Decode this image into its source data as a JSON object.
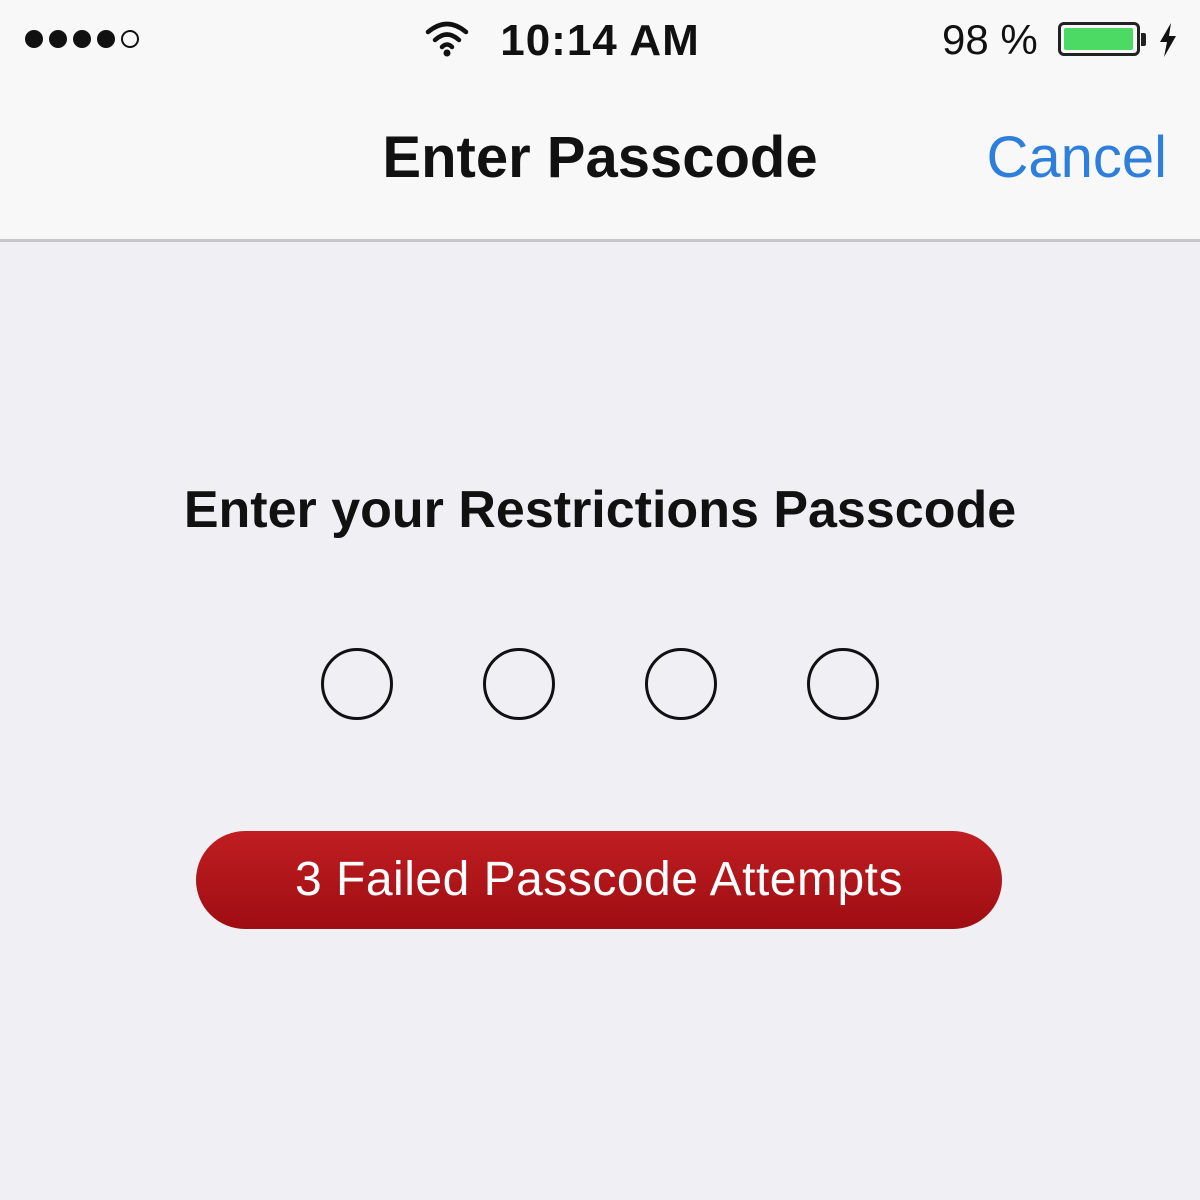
{
  "status_bar": {
    "signal_icon": "signal-strength-icon",
    "signal_bars_filled": 4,
    "signal_bars_total": 5,
    "wifi_icon": "wifi-icon",
    "time": "10:14 AM",
    "battery_percent": "98 %",
    "battery_level": 0.98,
    "battery_icon": "battery-icon",
    "battery_color": "#4cd964",
    "charging_icon": "charging-bolt-icon"
  },
  "nav_bar": {
    "title": "Enter Passcode",
    "cancel_label": "Cancel",
    "accent_color": "#2e7fdc"
  },
  "main": {
    "prompt": "Enter your Restrictions Passcode",
    "passcode_length": 4,
    "digits_entered": 0,
    "failed_attempts_message": "3 Failed Passcode Attempts",
    "failed_badge_color": "#b5161b"
  }
}
